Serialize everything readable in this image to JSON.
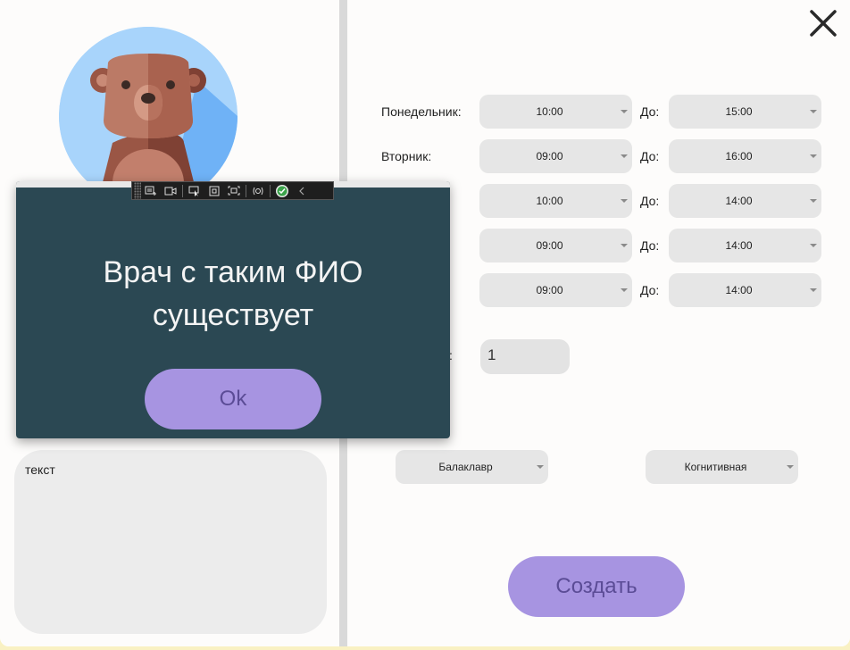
{
  "dialog": {
    "message_line1": "Врач с таким ФИО",
    "message_line2": "существует",
    "ok_label": "Ok"
  },
  "notes": {
    "text": "текст"
  },
  "schedule": [
    {
      "day": "Понедельник:",
      "from": "10:00",
      "to_label": "До:",
      "to": "15:00"
    },
    {
      "day": "Вторник:",
      "from": "09:00",
      "to_label": "До:",
      "to": "16:00"
    },
    {
      "day": "",
      "from": "10:00",
      "to_label": "До:",
      "to": "14:00"
    },
    {
      "day": "",
      "from": "09:00",
      "to_label": "До:",
      "to": "14:00"
    },
    {
      "day": "",
      "from": "09:00",
      "to_label": "До:",
      "to": "14:00"
    }
  ],
  "cabinet": {
    "label_fragment": ":",
    "value": "1"
  },
  "degree": {
    "selected": "Балаклавр"
  },
  "specialty": {
    "selected": "Когнитивная"
  },
  "create_button": {
    "label": "Создать"
  },
  "debug_toolbar": {
    "icons": [
      "grip-icon",
      "live-tree-icon",
      "record-icon",
      "select-element-icon",
      "display-layout-adorners-icon",
      "track-focus-icon",
      "hot-reload-icon",
      "binding-failures-ok-icon",
      "collapse-chevron-icon"
    ]
  },
  "colors": {
    "accent_button": "#a794e1",
    "dialog_background": "#2b4853",
    "window_frame": "#f9f1c3"
  }
}
